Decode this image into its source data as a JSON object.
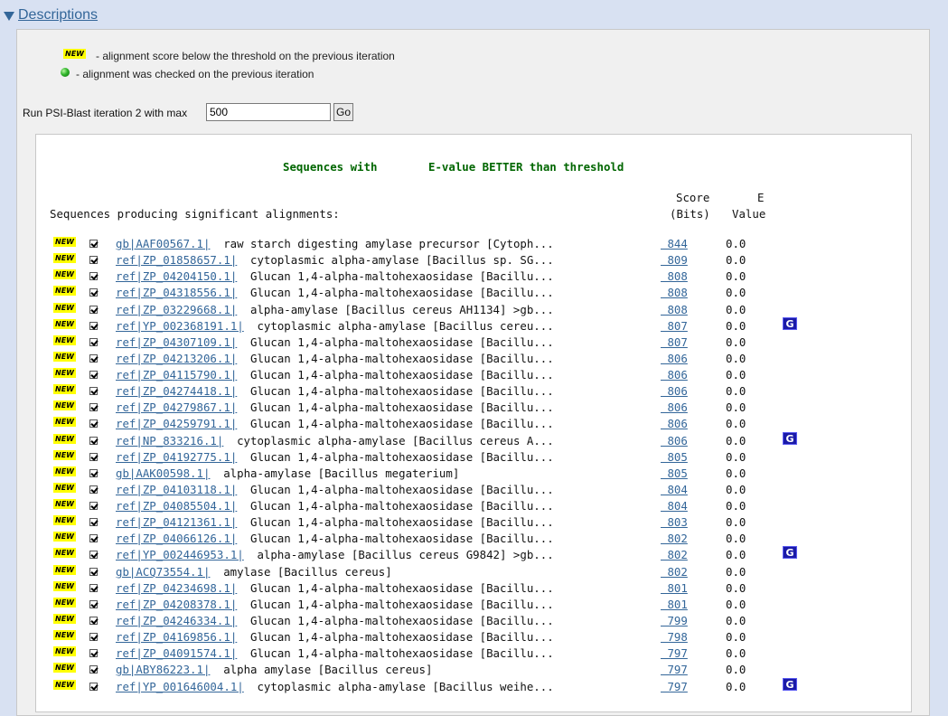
{
  "section": {
    "title": "Descriptions"
  },
  "legend": {
    "new_badge": "NEW",
    "new_text": " - alignment score below the threshold on the previous iteration",
    "checked_text": " - alignment was checked on the previous iteration"
  },
  "psi_form": {
    "label": "Run PSI-Blast iteration 2 with max",
    "max_value": "500",
    "go_label": "Go"
  },
  "results": {
    "heading_part1": "Sequences with",
    "heading_part2": "E-value BETTER than threshold",
    "column_left": "Sequences producing significant alignments:",
    "score_header_1": "Score",
    "score_header_2": "(Bits)",
    "evalue_header_1": "E",
    "evalue_header_2": "Value",
    "gene_icon_label": "G",
    "rows": [
      {
        "acc": "gb|AAF00567.1|",
        "desc": "raw starch digesting amylase precursor [Cytoph...",
        "score": "844",
        "evalue": "0.0",
        "gene": false
      },
      {
        "acc": "ref|ZP_01858657.1|",
        "desc": "cytoplasmic alpha-amylase [Bacillus sp. SG...",
        "score": "809",
        "evalue": "0.0",
        "gene": false
      },
      {
        "acc": "ref|ZP_04204150.1|",
        "desc": "Glucan 1,4-alpha-maltohexaosidase [Bacillu...",
        "score": "808",
        "evalue": "0.0",
        "gene": false
      },
      {
        "acc": "ref|ZP_04318556.1|",
        "desc": "Glucan 1,4-alpha-maltohexaosidase [Bacillu...",
        "score": "808",
        "evalue": "0.0",
        "gene": false
      },
      {
        "acc": "ref|ZP_03229668.1|",
        "desc": "alpha-amylase [Bacillus cereus AH1134] >gb...",
        "score": "808",
        "evalue": "0.0",
        "gene": false
      },
      {
        "acc": "ref|YP_002368191.1|",
        "desc": "cytoplasmic alpha-amylase [Bacillus cereu...",
        "score": "807",
        "evalue": "0.0",
        "gene": true
      },
      {
        "acc": "ref|ZP_04307109.1|",
        "desc": "Glucan 1,4-alpha-maltohexaosidase [Bacillu...",
        "score": "807",
        "evalue": "0.0",
        "gene": false
      },
      {
        "acc": "ref|ZP_04213206.1|",
        "desc": "Glucan 1,4-alpha-maltohexaosidase [Bacillu...",
        "score": "806",
        "evalue": "0.0",
        "gene": false
      },
      {
        "acc": "ref|ZP_04115790.1|",
        "desc": "Glucan 1,4-alpha-maltohexaosidase [Bacillu...",
        "score": "806",
        "evalue": "0.0",
        "gene": false
      },
      {
        "acc": "ref|ZP_04274418.1|",
        "desc": "Glucan 1,4-alpha-maltohexaosidase [Bacillu...",
        "score": "806",
        "evalue": "0.0",
        "gene": false
      },
      {
        "acc": "ref|ZP_04279867.1|",
        "desc": "Glucan 1,4-alpha-maltohexaosidase [Bacillu...",
        "score": "806",
        "evalue": "0.0",
        "gene": false
      },
      {
        "acc": "ref|ZP_04259791.1|",
        "desc": "Glucan 1,4-alpha-maltohexaosidase [Bacillu...",
        "score": "806",
        "evalue": "0.0",
        "gene": false
      },
      {
        "acc": "ref|NP_833216.1|",
        "desc": "cytoplasmic alpha-amylase [Bacillus cereus A...",
        "score": "806",
        "evalue": "0.0",
        "gene": true
      },
      {
        "acc": "ref|ZP_04192775.1|",
        "desc": "Glucan 1,4-alpha-maltohexaosidase [Bacillu...",
        "score": "805",
        "evalue": "0.0",
        "gene": false
      },
      {
        "acc": "gb|AAK00598.1|",
        "desc": "alpha-amylase [Bacillus megaterium]",
        "score": "805",
        "evalue": "0.0",
        "gene": false
      },
      {
        "acc": "ref|ZP_04103118.1|",
        "desc": "Glucan 1,4-alpha-maltohexaosidase [Bacillu...",
        "score": "804",
        "evalue": "0.0",
        "gene": false
      },
      {
        "acc": "ref|ZP_04085504.1|",
        "desc": "Glucan 1,4-alpha-maltohexaosidase [Bacillu...",
        "score": "804",
        "evalue": "0.0",
        "gene": false
      },
      {
        "acc": "ref|ZP_04121361.1|",
        "desc": "Glucan 1,4-alpha-maltohexaosidase [Bacillu...",
        "score": "803",
        "evalue": "0.0",
        "gene": false
      },
      {
        "acc": "ref|ZP_04066126.1|",
        "desc": "Glucan 1,4-alpha-maltohexaosidase [Bacillu...",
        "score": "802",
        "evalue": "0.0",
        "gene": false
      },
      {
        "acc": "ref|YP_002446953.1|",
        "desc": "alpha-amylase [Bacillus cereus G9842] >gb...",
        "score": "802",
        "evalue": "0.0",
        "gene": true
      },
      {
        "acc": "gb|ACQ73554.1|",
        "desc": "amylase [Bacillus cereus]",
        "score": "802",
        "evalue": "0.0",
        "gene": false
      },
      {
        "acc": "ref|ZP_04234698.1|",
        "desc": "Glucan 1,4-alpha-maltohexaosidase [Bacillu...",
        "score": "801",
        "evalue": "0.0",
        "gene": false
      },
      {
        "acc": "ref|ZP_04208378.1|",
        "desc": "Glucan 1,4-alpha-maltohexaosidase [Bacillu...",
        "score": "801",
        "evalue": "0.0",
        "gene": false
      },
      {
        "acc": "ref|ZP_04246334.1|",
        "desc": "Glucan 1,4-alpha-maltohexaosidase [Bacillu...",
        "score": "799",
        "evalue": "0.0",
        "gene": false
      },
      {
        "acc": "ref|ZP_04169856.1|",
        "desc": "Glucan 1,4-alpha-maltohexaosidase [Bacillu...",
        "score": "798",
        "evalue": "0.0",
        "gene": false
      },
      {
        "acc": "ref|ZP_04091574.1|",
        "desc": "Glucan 1,4-alpha-maltohexaosidase [Bacillu...",
        "score": "797",
        "evalue": "0.0",
        "gene": false
      },
      {
        "acc": "gb|ABY86223.1|",
        "desc": "alpha amylase [Bacillus cereus]",
        "score": "797",
        "evalue": "0.0",
        "gene": false
      },
      {
        "acc": "ref|YP_001646004.1|",
        "desc": "cytoplasmic alpha-amylase [Bacillus weihe...",
        "score": "797",
        "evalue": "0.0",
        "gene": true
      }
    ]
  }
}
